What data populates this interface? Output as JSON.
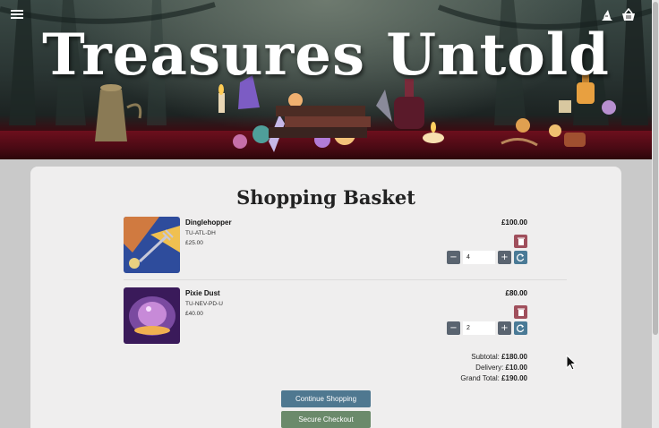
{
  "app": {
    "title": "Treasures Untold"
  },
  "header": {
    "menu_icon": "hamburger-icon",
    "account_icon": "wizard-hat-icon",
    "basket_icon": "basket-icon"
  },
  "basket": {
    "heading": "Shopping Basket",
    "items": [
      {
        "name": "Dinglehopper",
        "sku": "TU-ATL-DH",
        "unit_price": "£25.00",
        "line_total": "£100.00",
        "quantity": "4"
      },
      {
        "name": "Pixie Dust",
        "sku": "TU-NEV-PD-U",
        "unit_price": "£40.00",
        "line_total": "£80.00",
        "quantity": "2"
      }
    ],
    "totals": {
      "subtotal_label": "Subtotal:",
      "subtotal_value": "£180.00",
      "delivery_label": "Delivery:",
      "delivery_value": "£10.00",
      "grand_label": "Grand Total:",
      "grand_value": "£190.00"
    },
    "buttons": {
      "continue": "Continue Shopping",
      "checkout": "Secure Checkout"
    }
  },
  "colors": {
    "delete": "#a04f5c",
    "update": "#4a7a96",
    "stepper": "#5a6470",
    "continue": "#4f7890",
    "checkout": "#6b8a6b"
  }
}
